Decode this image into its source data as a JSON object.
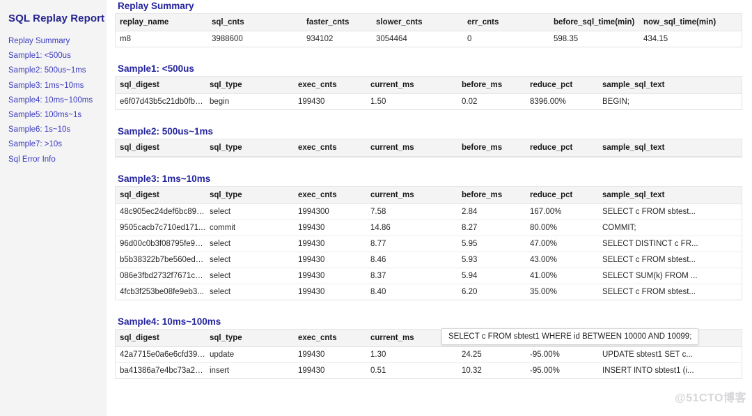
{
  "sidebar": {
    "title": "SQL Replay Report",
    "items": [
      {
        "label": "Replay Summary",
        "name": "sidebar-item-replay-summary"
      },
      {
        "label": "Sample1: <500us",
        "name": "sidebar-item-sample1"
      },
      {
        "label": "Sample2: 500us~1ms",
        "name": "sidebar-item-sample2"
      },
      {
        "label": "Sample3: 1ms~10ms",
        "name": "sidebar-item-sample3"
      },
      {
        "label": "Sample4: 10ms~100ms",
        "name": "sidebar-item-sample4"
      },
      {
        "label": "Sample5: 100ms~1s",
        "name": "sidebar-item-sample5"
      },
      {
        "label": "Sample6: 1s~10s",
        "name": "sidebar-item-sample6"
      },
      {
        "label": "Sample7: >10s",
        "name": "sidebar-item-sample7"
      },
      {
        "label": "Sql Error Info",
        "name": "sidebar-item-sql-error-info"
      }
    ]
  },
  "colors": {
    "heading": "#23239c",
    "sidebar_link": "#3b3bbf",
    "sidebar_bg": "#f4f4f5",
    "table_header_bg": "#f4f4f4",
    "border": "#e6e6e6"
  },
  "summary": {
    "title": "Replay Summary",
    "columns": [
      "replay_name",
      "sql_cnts",
      "faster_cnts",
      "slower_cnts",
      "err_cnts",
      "before_sql_time(min)",
      "now_sql_time(min)"
    ],
    "rows": [
      [
        "m8",
        "3988600",
        "934102",
        "3054464",
        "0",
        "598.35",
        "434.15"
      ]
    ]
  },
  "sample_columns": [
    "sql_digest",
    "sql_type",
    "exec_cnts",
    "current_ms",
    "before_ms",
    "reduce_pct",
    "sample_sql_text"
  ],
  "sample1": {
    "title": "Sample1: <500us",
    "rows": [
      [
        "e6f07d43b5c21db0fbb...",
        "begin",
        "199430",
        "1.50",
        "0.02",
        "8396.00%",
        "BEGIN;"
      ]
    ]
  },
  "sample2": {
    "title": "Sample2: 500us~1ms",
    "rows": []
  },
  "sample3": {
    "title": "Sample3: 1ms~10ms",
    "rows": [
      [
        "48c905ec24def6bc893...",
        "select",
        "1994300",
        "7.58",
        "2.84",
        "167.00%",
        "SELECT c FROM sbtest..."
      ],
      [
        "9505cacb7c710ed171...",
        "commit",
        "199430",
        "14.86",
        "8.27",
        "80.00%",
        "COMMIT;"
      ],
      [
        "96d00c0b3f08795fe94...",
        "select",
        "199430",
        "8.77",
        "5.95",
        "47.00%",
        "SELECT DISTINCT c FR..."
      ],
      [
        "b5b38322b7be560edb...",
        "select",
        "199430",
        "8.46",
        "5.93",
        "43.00%",
        "SELECT c FROM sbtest..."
      ],
      [
        "086e3fbd2732f7671c1...",
        "select",
        "199430",
        "8.37",
        "5.94",
        "41.00%",
        "SELECT SUM(k) FROM ..."
      ],
      [
        "4fcb3f253be08fe9eb3...",
        "select",
        "199430",
        "8.40",
        "6.20",
        "35.00%",
        "SELECT c FROM sbtest..."
      ]
    ]
  },
  "sample4": {
    "title": "Sample4: 10ms~100ms",
    "rows": [
      [
        "42a7715e0a6e6cfd39e...",
        "update",
        "199430",
        "1.30",
        "24.25",
        "-95.00%",
        "UPDATE sbtest1 SET c..."
      ],
      [
        "ba41386a7e4bc73a26...",
        "insert",
        "199430",
        "0.51",
        "10.32",
        "-95.00%",
        "INSERT INTO sbtest1 (i..."
      ]
    ]
  },
  "tooltip": {
    "text": "SELECT c FROM sbtest1 WHERE id BETWEEN 10000 AND 10099;"
  },
  "watermark": {
    "text": "@51CTO博客"
  }
}
